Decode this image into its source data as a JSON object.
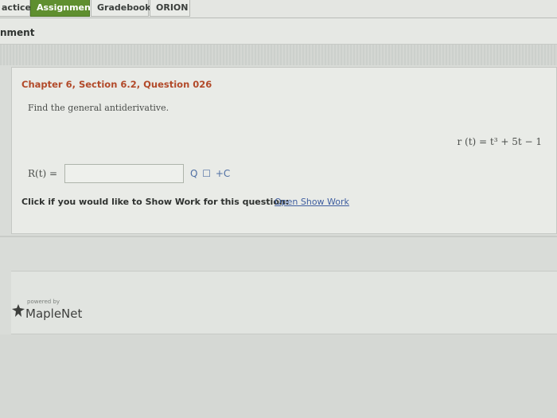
{
  "tabs": [
    "actice",
    "Assignment",
    "Gradebook",
    "ORION"
  ],
  "subbar": {
    "title": "nment"
  },
  "question": {
    "title": "Chapter 6, Section 6.2, Question 026",
    "prompt": "Find the general antiderivative.",
    "formula": "r (t) = t³ + 5t − 1",
    "answer_label": "R(t) =",
    "answer_value": "",
    "tools": [
      "Q",
      "☐",
      "+C"
    ],
    "showwork_text": "Click if you would like to Show Work for this question:",
    "showwork_link": "Open Show Work"
  },
  "footer": {
    "powered": "powered by",
    "brand": "MapleNet"
  }
}
